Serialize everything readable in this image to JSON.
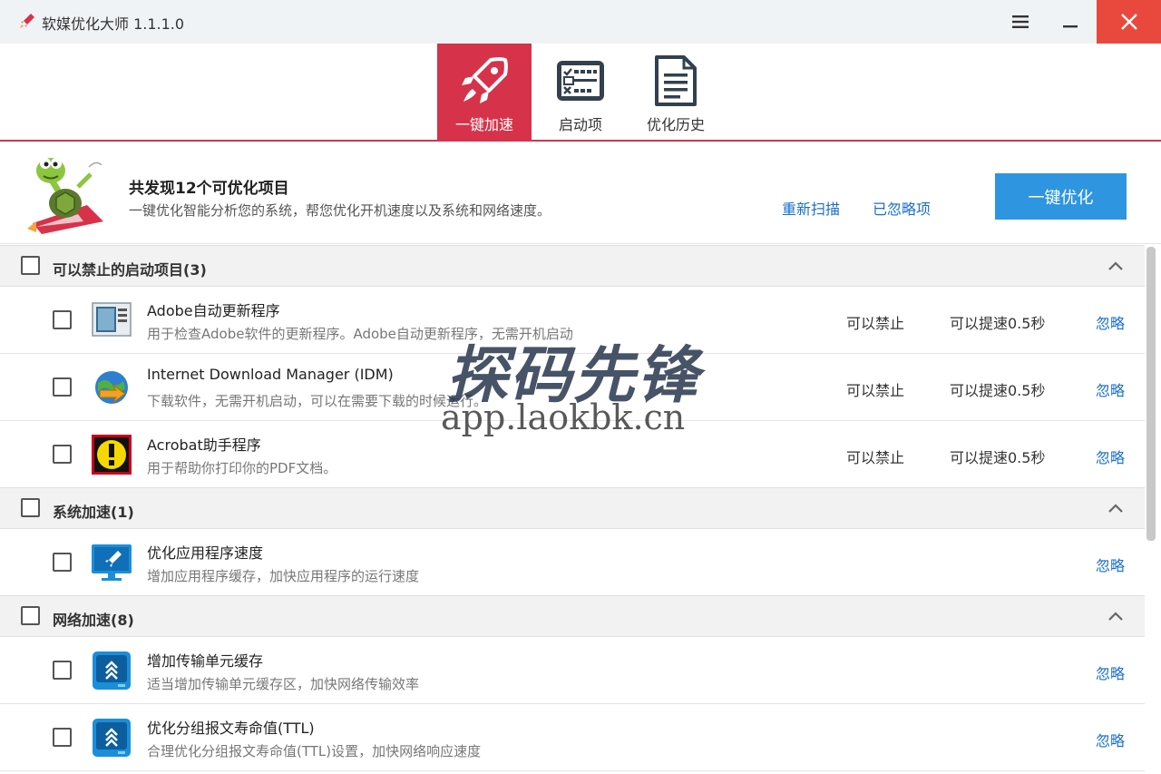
{
  "window": {
    "title": "软媒优化大师 1.1.1.0",
    "icons": {
      "app": "rocket-icon",
      "menu": "hamburger-icon",
      "minimize": "minimize-icon",
      "close": "close-icon"
    }
  },
  "tabs": [
    {
      "label": "一键加速",
      "icon": "rocket-icon",
      "active": true
    },
    {
      "label": "启动项",
      "icon": "startup-list-icon",
      "active": false
    },
    {
      "label": "优化历史",
      "icon": "document-icon",
      "active": false
    }
  ],
  "summary": {
    "title": "共发现12个可优化项目",
    "description": "一键优化智能分析您的系统，帮您优化开机速度以及系统和网络速度。",
    "rescan_label": "重新扫描",
    "ignored_label": "已忽略项",
    "optimize_label": "一键优化"
  },
  "groups": [
    {
      "title": "可以禁止的启动项目(3)",
      "items": [
        {
          "name": "Adobe自动更新程序",
          "desc": "用于检查Adobe软件的更新程序。Adobe自动更新程序，无需开机启动",
          "status": "可以禁止",
          "speed": "可以提速0.5秒",
          "ignore": "忽略",
          "icon": "adobe-updater-icon"
        },
        {
          "name": "Internet Download Manager (IDM)",
          "desc": "下载软件，无需开机启动，可以在需要下载的时候运行。",
          "status": "可以禁止",
          "speed": "可以提速0.5秒",
          "ignore": "忽略",
          "icon": "idm-globe-icon"
        },
        {
          "name": "Acrobat助手程序",
          "desc": "用于帮助你打印你的PDF文档。",
          "status": "可以禁止",
          "speed": "可以提速0.5秒",
          "ignore": "忽略",
          "icon": "warning-icon"
        }
      ]
    },
    {
      "title": "系统加速(1)",
      "items": [
        {
          "name": "优化应用程序速度",
          "desc": "增加应用程序缓存，加快应用程序的运行速度",
          "ignore": "忽略",
          "icon": "monitor-rocket-icon"
        }
      ]
    },
    {
      "title": "网络加速(8)",
      "items": [
        {
          "name": "增加传输单元缓存",
          "desc": "适当增加传输单元缓存区，加快网络传输效率",
          "ignore": "忽略",
          "icon": "network-boost-icon"
        },
        {
          "name": "优化分组报文寿命值(TTL)",
          "desc": "合理优化分组报文寿命值(TTL)设置，加快网络响应速度",
          "ignore": "忽略",
          "icon": "network-boost-icon"
        }
      ]
    }
  ],
  "watermark": {
    "main": "探码先锋",
    "url": "app.laokbk.cn"
  },
  "colors": {
    "accent_red": "#d6334a",
    "button_blue": "#2e95e0",
    "link_blue": "#1a6ecb",
    "close_red": "#e8493c"
  }
}
